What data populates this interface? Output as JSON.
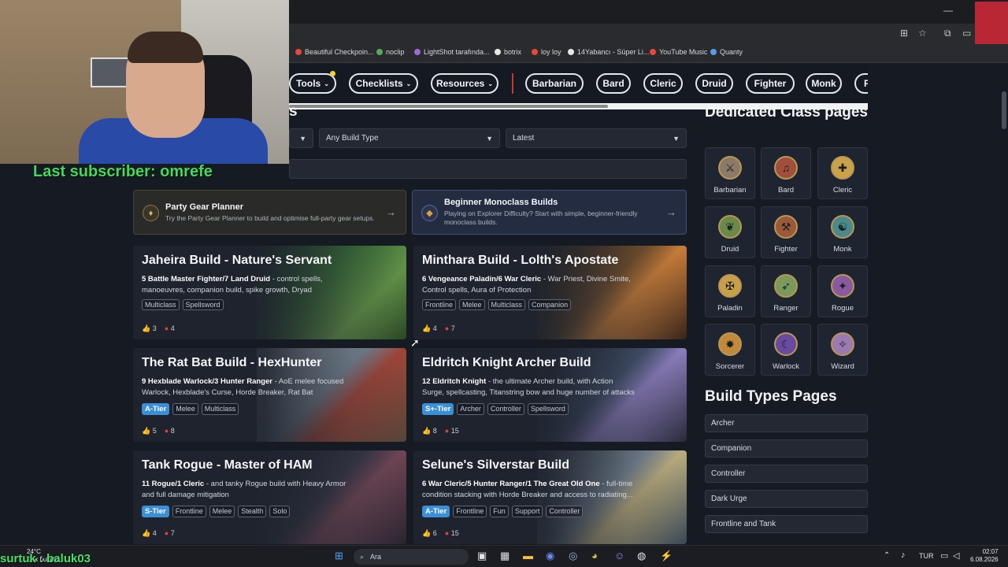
{
  "browser": {
    "bookmarks": [
      {
        "label": "Beautiful Checkpoin...",
        "color": "#e5483a"
      },
      {
        "label": "noclip",
        "color": "#5aa85a"
      },
      {
        "label": "LightShot tarafında...",
        "color": "#9a6ad6"
      },
      {
        "label": "botrix",
        "color": "#e6e6e6"
      },
      {
        "label": "loy loy",
        "color": "#e5483a"
      },
      {
        "label": "14Yabancı - Süper Li...",
        "color": "#e6e6e6"
      },
      {
        "label": "YouTube Music",
        "color": "#e5483a"
      },
      {
        "label": "Quanty",
        "color": "#5a9ae6"
      }
    ]
  },
  "stream_overlay": {
    "last_subscriber": "Last subscriber: omrefe",
    "bottom_user": "surtuk : baluk03"
  },
  "nav": {
    "items": [
      {
        "label": "Tools",
        "dropdown": true
      },
      {
        "label": "Checklists",
        "dropdown": true
      },
      {
        "label": "Resources",
        "dropdown": true
      }
    ],
    "classes": [
      "Barbarian",
      "Bard",
      "Cleric",
      "Druid",
      "Fighter",
      "Monk",
      "P"
    ]
  },
  "filters": {
    "section_heading_fragment": "s",
    "build_type": "Any Build Type",
    "sort": "Latest"
  },
  "promos": [
    {
      "title": "Party Gear Planner",
      "desc": "Try the Party Gear Planner to build and optimise full-party gear setups.",
      "arrow": "→"
    },
    {
      "title": "Beginner Monoclass Builds",
      "desc": "Playing on Explorer Difficulty? Start with simple, beginner-friendly monoclass builds.",
      "arrow": "→"
    }
  ],
  "builds": [
    {
      "title": "Jaheira Build - Nature's Servant",
      "classes": "5 Battle Master Fighter/7 Land Druid",
      "desc": " - control spells, manoeuvres, companion build, spike growth, Dryad",
      "tier": "",
      "tags": [
        "Multiclass",
        "Spellsword"
      ],
      "likes": "3",
      "comments": "4"
    },
    {
      "title": "Minthara Build - Lolth's Apostate",
      "classes": "6 Vengeance Paladin/6 War Cleric",
      "desc": " - War Priest, Divine Smite, Control spells, Aura of Protection",
      "tier": "",
      "tags": [
        "Frontline",
        "Melee",
        "Multiclass",
        "Companion"
      ],
      "likes": "4",
      "comments": "7"
    },
    {
      "title": "The Rat Bat Build - HexHunter",
      "classes": "9 Hexblade Warlock/3 Hunter Ranger",
      "desc": " - AoE melee focused Warlock, Hexblade's Curse, Horde Breaker, Rat Bat",
      "tier": "A-Tier",
      "tags": [
        "Melee",
        "Multiclass"
      ],
      "likes": "5",
      "comments": "8"
    },
    {
      "title": "Eldritch Knight Archer Build",
      "classes": "12 Eldritch Knight",
      "desc": " - the ultimate Archer build, with Action Surge, spellcasting, Titanstring bow and huge number of attacks",
      "tier": "S+-Tier",
      "tags": [
        "Archer",
        "Controller",
        "Spellsword"
      ],
      "likes": "8",
      "comments": "15"
    },
    {
      "title": "Tank Rogue - Master of HAM",
      "classes": "11 Rogue/1 Cleric",
      "desc": " - and tanky Rogue build with Heavy Armor and full damage mitigation",
      "tier": "S-Tier",
      "tags": [
        "Frontline",
        "Melee",
        "Stealth",
        "Solo"
      ],
      "likes": "4",
      "comments": "7"
    },
    {
      "title": "Selune's Silverstar Build",
      "classes": "6 War Cleric/5 Hunter Ranger/1 The Great Old One",
      "desc": " - full-time condition stacking with Horde Breaker and access to radiating...",
      "tier": "A-Tier",
      "tags": [
        "Frontline",
        "Fun",
        "Support",
        "Controller"
      ],
      "likes": "6",
      "comments": "15"
    }
  ],
  "sidebar": {
    "class_pages_title": "Dedicated Class pages",
    "classes": [
      {
        "name": "Barbarian",
        "color": "#8a7a66"
      },
      {
        "name": "Bard",
        "color": "#a0503a"
      },
      {
        "name": "Cleric",
        "color": "#c9a24a"
      },
      {
        "name": "Druid",
        "color": "#6a8a4a"
      },
      {
        "name": "Fighter",
        "color": "#9a5a3a"
      },
      {
        "name": "Monk",
        "color": "#4a8a8a"
      },
      {
        "name": "Paladin",
        "color": "#c9a04a"
      },
      {
        "name": "Ranger",
        "color": "#7a9a5a"
      },
      {
        "name": "Rogue",
        "color": "#8a5aa0"
      },
      {
        "name": "Sorcerer",
        "color": "#c08a3a"
      },
      {
        "name": "Warlock",
        "color": "#6a4aa0"
      },
      {
        "name": "Wizard",
        "color": "#9a7ab0"
      }
    ],
    "build_types_title": "Build Types Pages",
    "build_types": [
      "Archer",
      "Companion",
      "Controller",
      "Dark Urge",
      "Frontline and Tank"
    ]
  },
  "taskbar": {
    "weather_temp": "24°C",
    "weather_desc": "Çok bulutlu",
    "search_placeholder": "Ara",
    "language": "TUR",
    "time": "02:07",
    "date": "6.08.2026"
  }
}
